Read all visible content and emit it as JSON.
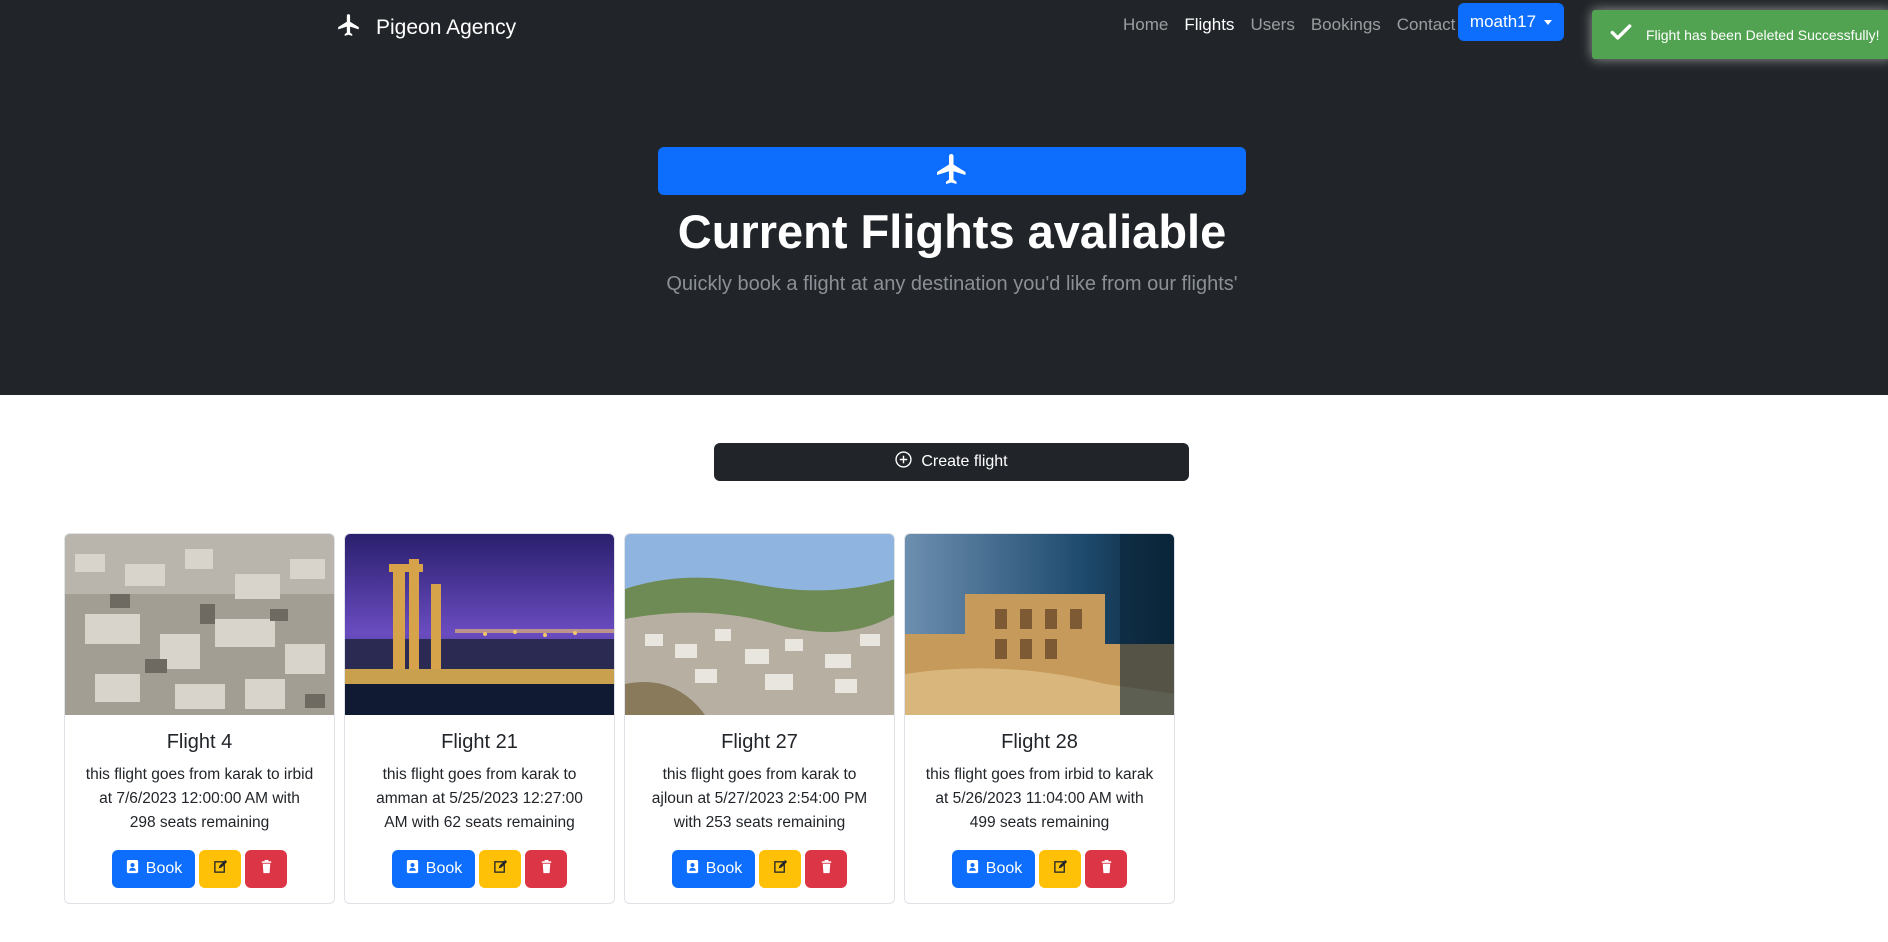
{
  "brand": {
    "name": "Pigeon Agency",
    "icon": "plane-icon"
  },
  "nav": {
    "items": [
      {
        "label": "Home",
        "active": false
      },
      {
        "label": "Flights",
        "active": true
      },
      {
        "label": "Users",
        "active": false
      },
      {
        "label": "Bookings",
        "active": false
      },
      {
        "label": "Contact",
        "active": false
      }
    ],
    "user_menu_label": "moath17"
  },
  "toast": {
    "message": "Flight has been Deleted Successfully!",
    "icon": "check-icon",
    "color": "#51a351"
  },
  "hero": {
    "title": "Current Flights avaliable",
    "subtitle": "Quickly book a flight at any destination you'd like from our flights'",
    "banner_icon": "plane-icon"
  },
  "create_button": {
    "label": "Create flight",
    "icon": "plus-circle-icon"
  },
  "flights": [
    {
      "title": "Flight 4",
      "description": "this flight goes from karak to irbid at 7/6/2023 12:00:00 AM with 298 seats remaining",
      "image": "aerial city photo",
      "book_label": "Book"
    },
    {
      "title": "Flight 21",
      "description": "this flight goes from karak to amman at 5/25/2023 12:27:00 AM with 62 seats remaining",
      "image": "temple ruins at night photo",
      "book_label": "Book"
    },
    {
      "title": "Flight 27",
      "description": "this flight goes from karak to ajloun at 5/27/2023 2:54:00 PM with 253 seats remaining",
      "image": "hillside town photo",
      "book_label": "Book"
    },
    {
      "title": "Flight 28",
      "description": "this flight goes from irbid to karak at 5/26/2023 11:04:00 AM with 499 seats remaining",
      "image": "castle ruins photo",
      "book_label": "Book"
    }
  ],
  "colors": {
    "dark": "#212529",
    "primary": "#0d6efd",
    "warning": "#ffc107",
    "danger": "#dc3545",
    "success": "#51a351"
  }
}
